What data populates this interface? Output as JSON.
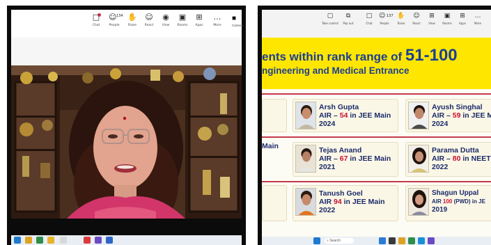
{
  "left": {
    "toolbar": {
      "items": [
        {
          "label": "Chat",
          "icon": "chat-icon",
          "glyph": "□"
        },
        {
          "label": "People",
          "icon": "people-icon",
          "glyph": "☺",
          "count": "134"
        },
        {
          "label": "Raise",
          "icon": "raise-hand-icon",
          "glyph": "✋"
        },
        {
          "label": "React",
          "icon": "react-icon",
          "glyph": "☺"
        },
        {
          "label": "View",
          "icon": "view-icon",
          "glyph": "◉"
        },
        {
          "label": "Rooms",
          "icon": "rooms-icon",
          "glyph": "▣"
        },
        {
          "label": "Apps",
          "icon": "apps-icon",
          "glyph": "⊞"
        },
        {
          "label": "More",
          "icon": "more-icon",
          "glyph": "…"
        }
      ],
      "camera": {
        "label": "Camera",
        "icon": "camera-icon",
        "glyph": "■"
      }
    }
  },
  "right": {
    "toolbar": {
      "items": [
        {
          "label": "Take control",
          "icon": "take-control-icon",
          "glyph": "▢"
        },
        {
          "label": "Pop out",
          "icon": "pop-out-icon",
          "glyph": "⧉"
        },
        {
          "label": "Chat",
          "icon": "chat-icon",
          "glyph": "□"
        },
        {
          "label": "People",
          "icon": "people-icon",
          "glyph": "☺",
          "count": "137"
        },
        {
          "label": "Raise",
          "icon": "raise-hand-icon",
          "glyph": "✋"
        },
        {
          "label": "React",
          "icon": "react-icon",
          "glyph": "☺"
        },
        {
          "label": "View",
          "icon": "view-icon",
          "glyph": "⊞"
        },
        {
          "label": "Rooms",
          "icon": "rooms-icon",
          "glyph": "▣"
        },
        {
          "label": "Apps",
          "icon": "apps-icon",
          "glyph": "⊞"
        },
        {
          "label": "More",
          "icon": "more-icon",
          "glyph": "…"
        }
      ]
    },
    "slide": {
      "title_prefix": "ents within rank range of ",
      "title_range": "51-100",
      "subtitle": "ngineering and Medical Entrance",
      "left_fragment": "Main",
      "students": [
        {
          "name": "Arsh Gupta",
          "air_prefix": "AIR – ",
          "rank": "54",
          "air_suffix": " in JEE Main",
          "year": "2024"
        },
        {
          "name": "Ayush Singhal",
          "air_prefix": "AIR – ",
          "rank": "59",
          "air_suffix": " in JEE M",
          "year": "2024"
        },
        {
          "name": "Tejas Anand",
          "air_prefix": "AIR – ",
          "rank": "67",
          "air_suffix": "  in JEE Main",
          "year": "2021"
        },
        {
          "name": "Parama Dutta",
          "air_prefix": "AIR – ",
          "rank": "80",
          "air_suffix": " in NEET",
          "year": "2022"
        },
        {
          "name": "Tanush Goel",
          "air_prefix": "AIR ",
          "rank": "94",
          "air_suffix": " in JEE Main",
          "year": "2022"
        },
        {
          "name": "Shagun Uppal",
          "air_prefix": "AIR ",
          "rank": "100",
          "air_suffix": " (PWD) in JE",
          "year": "2019"
        }
      ]
    },
    "taskbar": {
      "search_placeholder": "Search"
    }
  },
  "colors": {
    "accent_blue": "#1b3f95",
    "rank_red": "#c8102e",
    "highlight_yellow": "#ffe600"
  }
}
